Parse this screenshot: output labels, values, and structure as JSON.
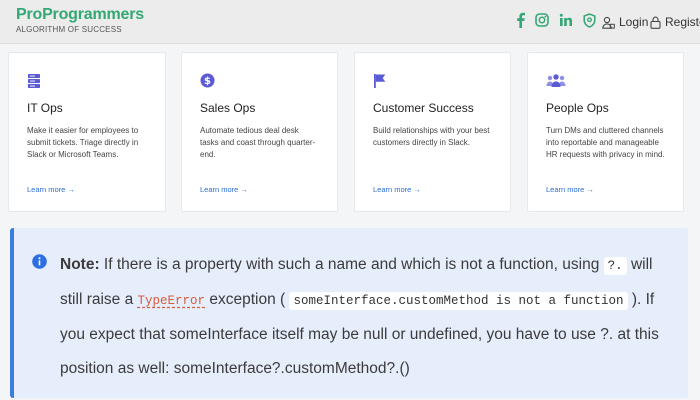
{
  "header": {
    "logo_title": "ProProgrammers",
    "logo_subtitle": "ALGORITHM OF SUCCESS",
    "socials": [
      "facebook-icon",
      "instagram-icon",
      "linkedin-icon",
      "shield-icon"
    ],
    "login_label": "Login",
    "register_label": "Register"
  },
  "cards": [
    {
      "icon": "server-icon",
      "title": "IT Ops",
      "description": "Make it easier for employees to submit tickets. Triage directly in Slack or Microsoft Teams.",
      "link": "Learn more →"
    },
    {
      "icon": "dollar-icon",
      "title": "Sales Ops",
      "description": "Automate tedious deal desk tasks and coast through quarter-end.",
      "link": "Learn more →"
    },
    {
      "icon": "flag-icon",
      "title": "Customer Success",
      "description": "Build relationships with your best customers directly in Slack.",
      "link": "Learn more →"
    },
    {
      "icon": "people-icon",
      "title": "People Ops",
      "description": "Turn DMs and cluttered channels into reportable and manageable HR requests with privacy in mind.",
      "link": "Learn more →"
    }
  ],
  "note": {
    "label": "Note:",
    "text_1": " If there is a property with such a name and which is not a function, using ",
    "code_1": "?.",
    "text_2": " will still raise a ",
    "code_link": "TypeError",
    "text_3": " exception ( ",
    "code_2": "someInterface.customMethod is not a function",
    "text_4": " ). If you expect that someInterface itself may be null or undefined, you have to use ?. at this position as well: someInterface?.customMethod?.()"
  },
  "colors": {
    "brand": "#33a874",
    "link": "#2b6fd6",
    "note_bg": "#e6eefc",
    "note_accent": "#3b7ddd"
  }
}
